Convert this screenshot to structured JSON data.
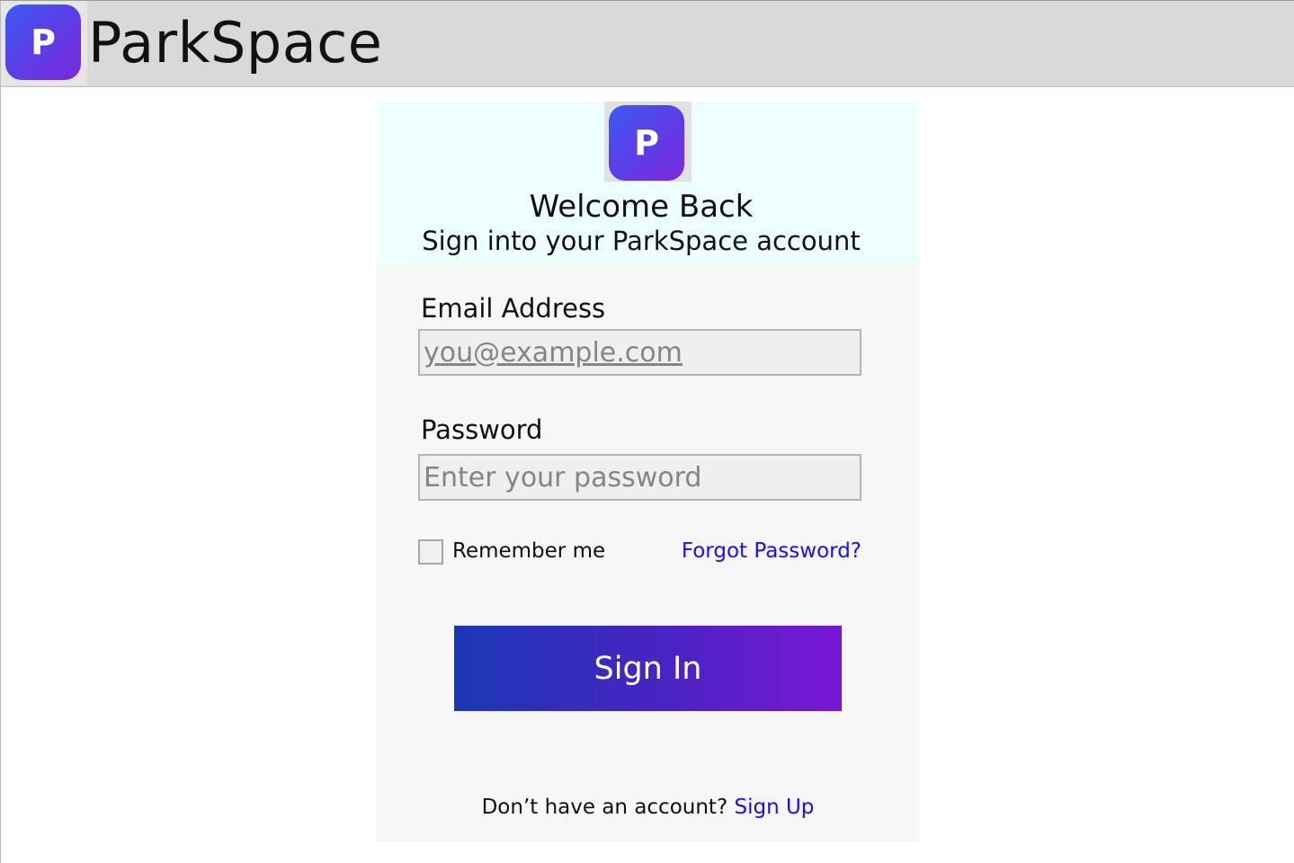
{
  "header": {
    "logo_letter": "P",
    "brand_name": "ParkSpace"
  },
  "card": {
    "logo_letter": "P",
    "title": "Welcome Back",
    "subtitle": "Sign into your ParkSpace account"
  },
  "form": {
    "email_label": "Email Address",
    "email_placeholder": "you@example.com",
    "email_value": "",
    "password_label": "Password",
    "password_placeholder": "Enter your password",
    "password_value": "",
    "remember_label": "Remember me",
    "remember_checked": false,
    "forgot_label": "Forgot Password?",
    "signin_label": "Sign In"
  },
  "footer": {
    "prompt": "Don’t have an account?",
    "signup_label": "Sign Up"
  },
  "colors": {
    "brand_gradient_start": "#3d5af1",
    "brand_gradient_end": "#7b2ad8",
    "link": "#1a0ef2",
    "button_gradient_start": "#1a37b6",
    "button_gradient_end": "#7a18d4",
    "header_bg": "#d9d9d9",
    "card_header_bg": "#ecfefe",
    "card_bg": "#f7f7f7"
  },
  "icons": {
    "header_logo": "parkspace-logo-icon",
    "card_logo": "parkspace-logo-icon",
    "checkbox": "checkbox-unchecked-icon"
  }
}
